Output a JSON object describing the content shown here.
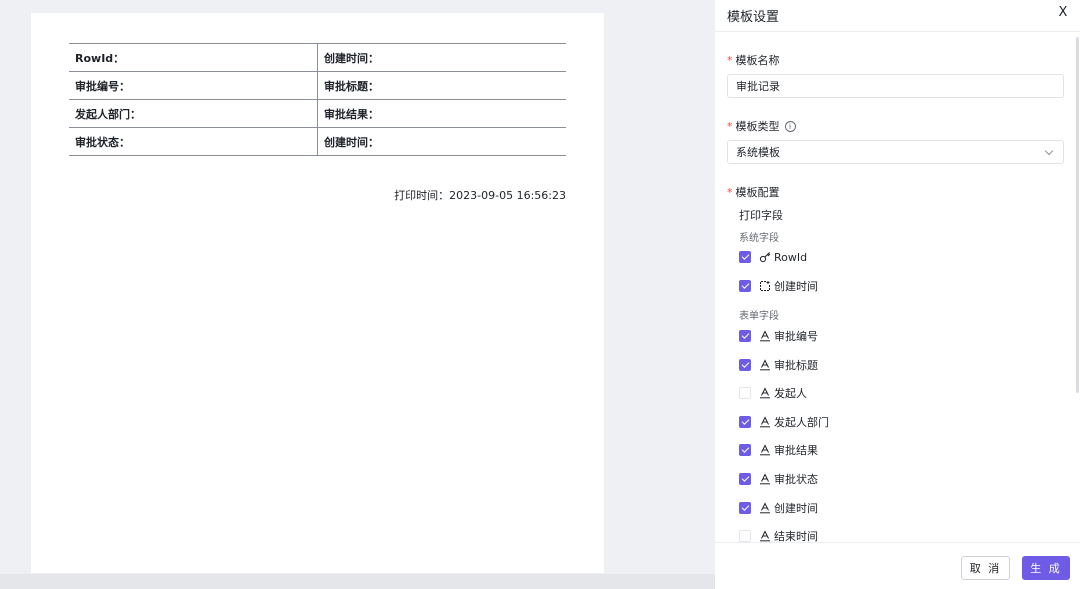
{
  "preview": {
    "table_rows": [
      [
        "RowId：",
        "创建时间："
      ],
      [
        "审批编号：",
        "审批标题："
      ],
      [
        "发起人部门：",
        "审批结果："
      ],
      [
        "审批状态：",
        "创建时间："
      ]
    ],
    "print_time": "打印时间：2023-09-05 16:56:23"
  },
  "panel": {
    "title": "模板设置",
    "close_label": "X",
    "required_mark": "*",
    "name_label": "模板名称",
    "name_value": "审批记录",
    "type_label": "模板类型",
    "type_info_icon": "i",
    "type_value": "系统模板",
    "config_label": "模板配置",
    "print_fields_label": "打印字段",
    "system_fields_label": "系统字段",
    "form_fields_label": "表单字段",
    "system_fields": [
      {
        "label": "RowId",
        "checked": true,
        "icon": "key-icon"
      },
      {
        "label": "创建时间",
        "checked": true,
        "icon": "calendar-icon"
      }
    ],
    "form_fields": [
      {
        "label": "审批编号",
        "checked": true,
        "icon": "text-field-icon"
      },
      {
        "label": "审批标题",
        "checked": true,
        "icon": "text-field-icon"
      },
      {
        "label": "发起人",
        "checked": false,
        "icon": "text-field-icon"
      },
      {
        "label": "发起人部门",
        "checked": true,
        "icon": "text-field-icon"
      },
      {
        "label": "审批结果",
        "checked": true,
        "icon": "text-field-icon"
      },
      {
        "label": "审批状态",
        "checked": true,
        "icon": "text-field-icon"
      },
      {
        "label": "创建时间",
        "checked": true,
        "icon": "text-field-icon"
      },
      {
        "label": "结束时间",
        "checked": false,
        "icon": "text-field-icon"
      }
    ],
    "cancel_label": "取 消",
    "generate_label": "生 成"
  },
  "colors": {
    "accent": "#6e5ce6",
    "required": "#f54a45",
    "background": "#eef0f3"
  }
}
